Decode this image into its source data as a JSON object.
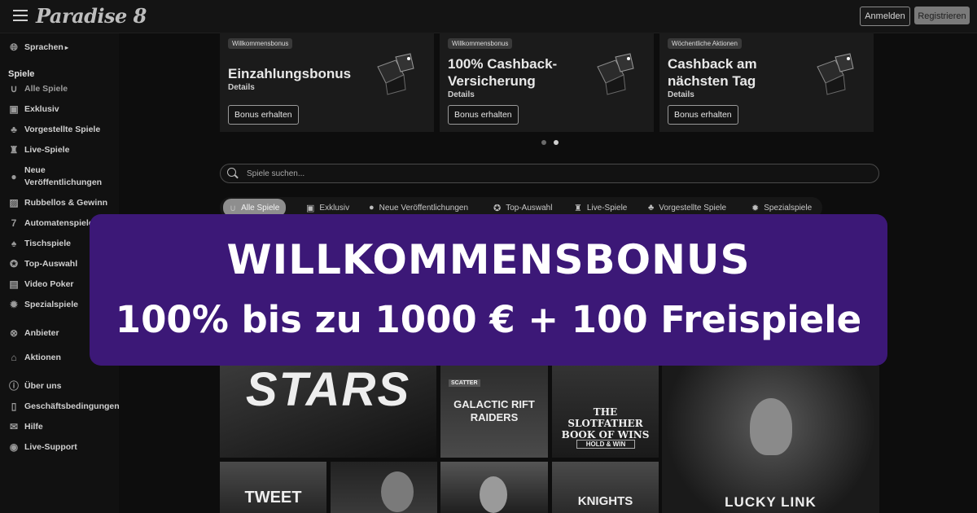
{
  "header": {
    "logo": "Paradise 8",
    "login_label": "Anmelden",
    "register_label": "Registrieren"
  },
  "sidebar": {
    "language_label": "Sprachen",
    "games_heading": "Spiele",
    "items": [
      {
        "label": "Alle Spiele",
        "icon": "horseshoe-icon"
      },
      {
        "label": "Exklusiv",
        "icon": "exclusive-icon"
      },
      {
        "label": "Vorgestellte Spiele",
        "icon": "clover-icon"
      },
      {
        "label": "Live-Spiele",
        "icon": "live-dealer-icon"
      },
      {
        "label": "Neue Veröffentlichungen",
        "icon": "cherries-icon"
      },
      {
        "label": "Rubbellos & Gewinn",
        "icon": "scratch-card-icon"
      },
      {
        "label": "Automatenspiele",
        "icon": "slot-seven-icon"
      },
      {
        "label": "Tischspiele",
        "icon": "playing-card-icon"
      },
      {
        "label": "Top-Auswahl",
        "icon": "medal-icon"
      },
      {
        "label": "Video Poker",
        "icon": "video-poker-icon"
      },
      {
        "label": "Spezialspiele",
        "icon": "gear-icon"
      }
    ],
    "providers_label": "Anbieter",
    "promotions_label": "Aktionen",
    "footer_items": [
      {
        "label": "Über uns",
        "icon": "info-icon"
      },
      {
        "label": "Geschäftsbedingungen",
        "icon": "document-icon"
      },
      {
        "label": "Hilfe",
        "icon": "mail-icon"
      },
      {
        "label": "Live-Support",
        "icon": "chat-icon"
      }
    ]
  },
  "banners": [
    {
      "tag": "Willkommensbonus",
      "title": "Einzahlungsbonus",
      "details": "Details",
      "cta": "Bonus erhalten"
    },
    {
      "tag": "Willkommensbonus",
      "title": "100% Cashback-Versicherung",
      "details": "Details",
      "cta": "Bonus erhalten"
    },
    {
      "tag": "Wöchentliche Aktionen",
      "title": "Cashback am nächsten Tag",
      "details": "Details",
      "cta": "Bonus erhalten"
    }
  ],
  "search": {
    "placeholder": "Spiele suchen..."
  },
  "tabs": [
    {
      "label": "Alle Spiele",
      "icon": "horseshoe-icon"
    },
    {
      "label": "Exklusiv",
      "icon": "exclusive-icon"
    },
    {
      "label": "Neue Veröffentlichungen",
      "icon": "cherries-icon"
    },
    {
      "label": "Top-Auswahl",
      "icon": "medal-icon"
    },
    {
      "label": "Live-Spiele",
      "icon": "live-dealer-icon"
    },
    {
      "label": "Vorgestellte Spiele",
      "icon": "clover-icon"
    },
    {
      "label": "Spezialspiele",
      "icon": "gear-icon"
    }
  ],
  "promo_overlay": {
    "title": "WILLKOMMENSBONUS",
    "subtitle": "100% bis zu 1000 € + 100 Freispiele"
  },
  "games": [
    {
      "title": "STARS"
    },
    {
      "badge": "SCATTER",
      "title": "GALACTIC RIFT RAIDERS"
    },
    {
      "title": "THE SLOTFATHER BOOK OF WINS",
      "badge": "HOLD & WIN"
    },
    {
      "title": "LUCKY LINK"
    },
    {
      "title": "TWEET"
    },
    {
      "title": ""
    },
    {
      "title": ""
    },
    {
      "title": "KNIGHTS"
    }
  ],
  "colors": {
    "overlay_bg": "#3c1877",
    "page_bg": "#0d0d0d",
    "overlay_text": "#ffffff"
  }
}
